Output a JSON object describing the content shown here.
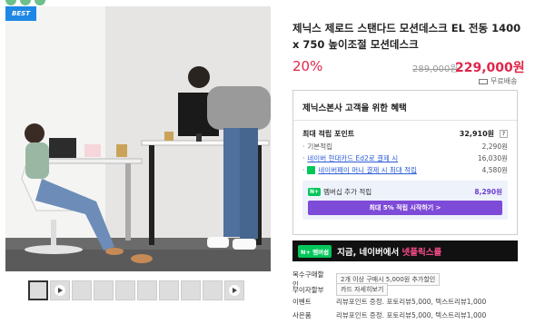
{
  "colors": {
    "accent": "#e0264a",
    "member": "#7e4ad8",
    "naver_green": "#03c75a",
    "best_badge": "#1e88e5"
  },
  "badge": "BEST",
  "product": {
    "title": "제닉스 제로드 스탠다드 모션데스크 EL 전동 1400 x 750 높이조절 모션데스크",
    "discount": "20%",
    "original_price": "289,000원",
    "price": "229,000원",
    "shipping": "무료배송"
  },
  "benefit": {
    "title": "제닉스본사 고객을 위한 혜택",
    "max_points_label": "최대 적립 포인트",
    "max_points_value": "32,910원",
    "help": "?",
    "rows": [
      {
        "label": "기본적립",
        "value": "2,290원"
      },
      {
        "label": "네이버 현대카드 Ed2로 결제 시",
        "value": "16,030원"
      },
      {
        "label": "네이버페이 머니 결제 시 최대 적립",
        "value": "4,580원"
      }
    ],
    "member": {
      "badge": "N+",
      "label": "멤버십 추가 적립",
      "value": "8,290원",
      "button": "최대 5% 적립 시작하기 >"
    }
  },
  "banner": {
    "badge": "N+ 멤버쉽",
    "text_prefix": "지금, 네이버에서 ",
    "text_highlight": "넷플릭스를"
  },
  "info": [
    {
      "key": "복수구매할인",
      "tag": "",
      "value": "2개 이상 구매시 5,000원 추가할인"
    },
    {
      "key": "무이자할부",
      "tag": "카드 자세히보기",
      "value": ""
    },
    {
      "key": "이벤트",
      "tag": "",
      "value": "리뷰포인트 증정. 포토리뷰5,000, 텍스트리뷰1,000"
    },
    {
      "key": "사은품",
      "tag": "",
      "value": "리뷰포인트 증정. 포토리뷰5,000, 텍스트리뷰1,000"
    }
  ],
  "thumbnails": [
    {
      "icon": "none"
    },
    {
      "icon": "play-icon"
    },
    {
      "icon": "none"
    },
    {
      "icon": "none"
    },
    {
      "icon": "none"
    },
    {
      "icon": "none"
    },
    {
      "icon": "none"
    },
    {
      "icon": "none"
    },
    {
      "icon": "none"
    },
    {
      "icon": "play-icon"
    }
  ]
}
